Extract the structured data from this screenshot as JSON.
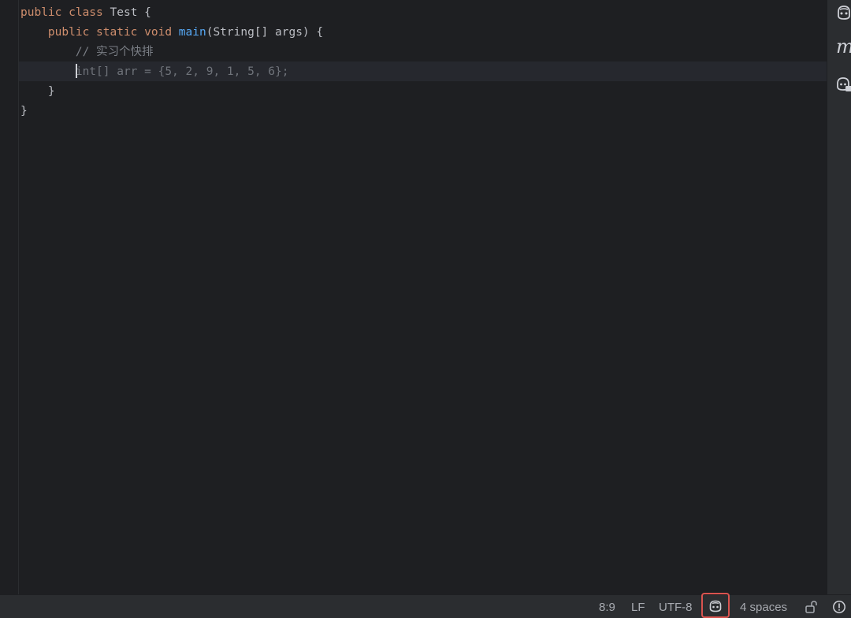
{
  "editor": {
    "lines": [
      {
        "tokens": [
          {
            "t": "public class ",
            "c": "kw"
          },
          {
            "t": "Test {",
            "c": ""
          }
        ]
      },
      {
        "tokens": [
          {
            "t": "    public static void ",
            "c": "kw"
          },
          {
            "t": "main",
            "c": "fn"
          },
          {
            "t": "(String[] args) {",
            "c": ""
          }
        ]
      },
      {
        "tokens": [
          {
            "t": "        // 实习个快排",
            "c": "cm"
          }
        ]
      },
      {
        "tokens": [
          {
            "t": "        ",
            "c": ""
          },
          {
            "t": "int[] arr = {5, 2, 9, 1, 5, 6};",
            "c": "ghost"
          }
        ]
      },
      {
        "tokens": [
          {
            "t": "    }",
            "c": ""
          }
        ]
      },
      {
        "tokens": [
          {
            "t": "}",
            "c": ""
          }
        ]
      }
    ]
  },
  "right_panel": {
    "icons": [
      "copilot-icon",
      "maven-icon",
      "copilot-chat-icon"
    ],
    "maven_letter": "m"
  },
  "status_bar": {
    "cursor_position": "8:9",
    "line_separator": "LF",
    "encoding": "UTF-8",
    "indent": "4 spaces",
    "icons": [
      "copilot-status-icon",
      "lock-open-icon",
      "notifications-icon"
    ]
  },
  "colors": {
    "background": "#1e1f22",
    "keyword": "#cf8e6d",
    "function": "#56a8f5",
    "comment": "#7a7e85",
    "suggestion": "#6f737a",
    "highlight_border": "#d9534f"
  }
}
